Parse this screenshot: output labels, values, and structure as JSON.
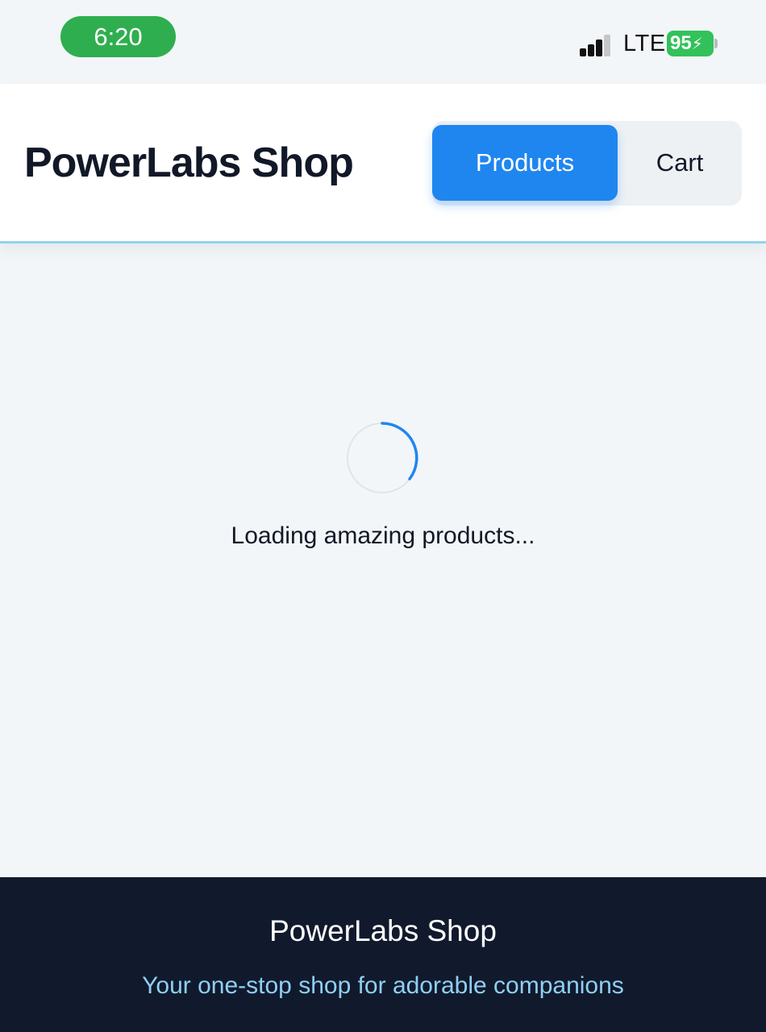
{
  "status_bar": {
    "time": "6:20",
    "network": "LTE",
    "battery": "95",
    "signal_icon": "cellular-signal-icon",
    "battery_icon": "battery-charging-icon"
  },
  "header": {
    "brand": "PowerLabs Shop",
    "nav": {
      "products_label": "Products",
      "cart_label": "Cart",
      "active": "Products"
    }
  },
  "main": {
    "spinner_icon": "loading-spinner-icon",
    "loading_text": "Loading amazing products..."
  },
  "footer": {
    "title": "PowerLabs Shop",
    "tagline": "Your one-stop shop for adorable companions"
  },
  "colors": {
    "accent": "#1f86f0",
    "footer_bg": "#111a2c",
    "footer_tagline": "#8fcff4",
    "header_border": "#93d2f0",
    "time_pill": "#2fae4f",
    "battery": "#33c15a"
  }
}
